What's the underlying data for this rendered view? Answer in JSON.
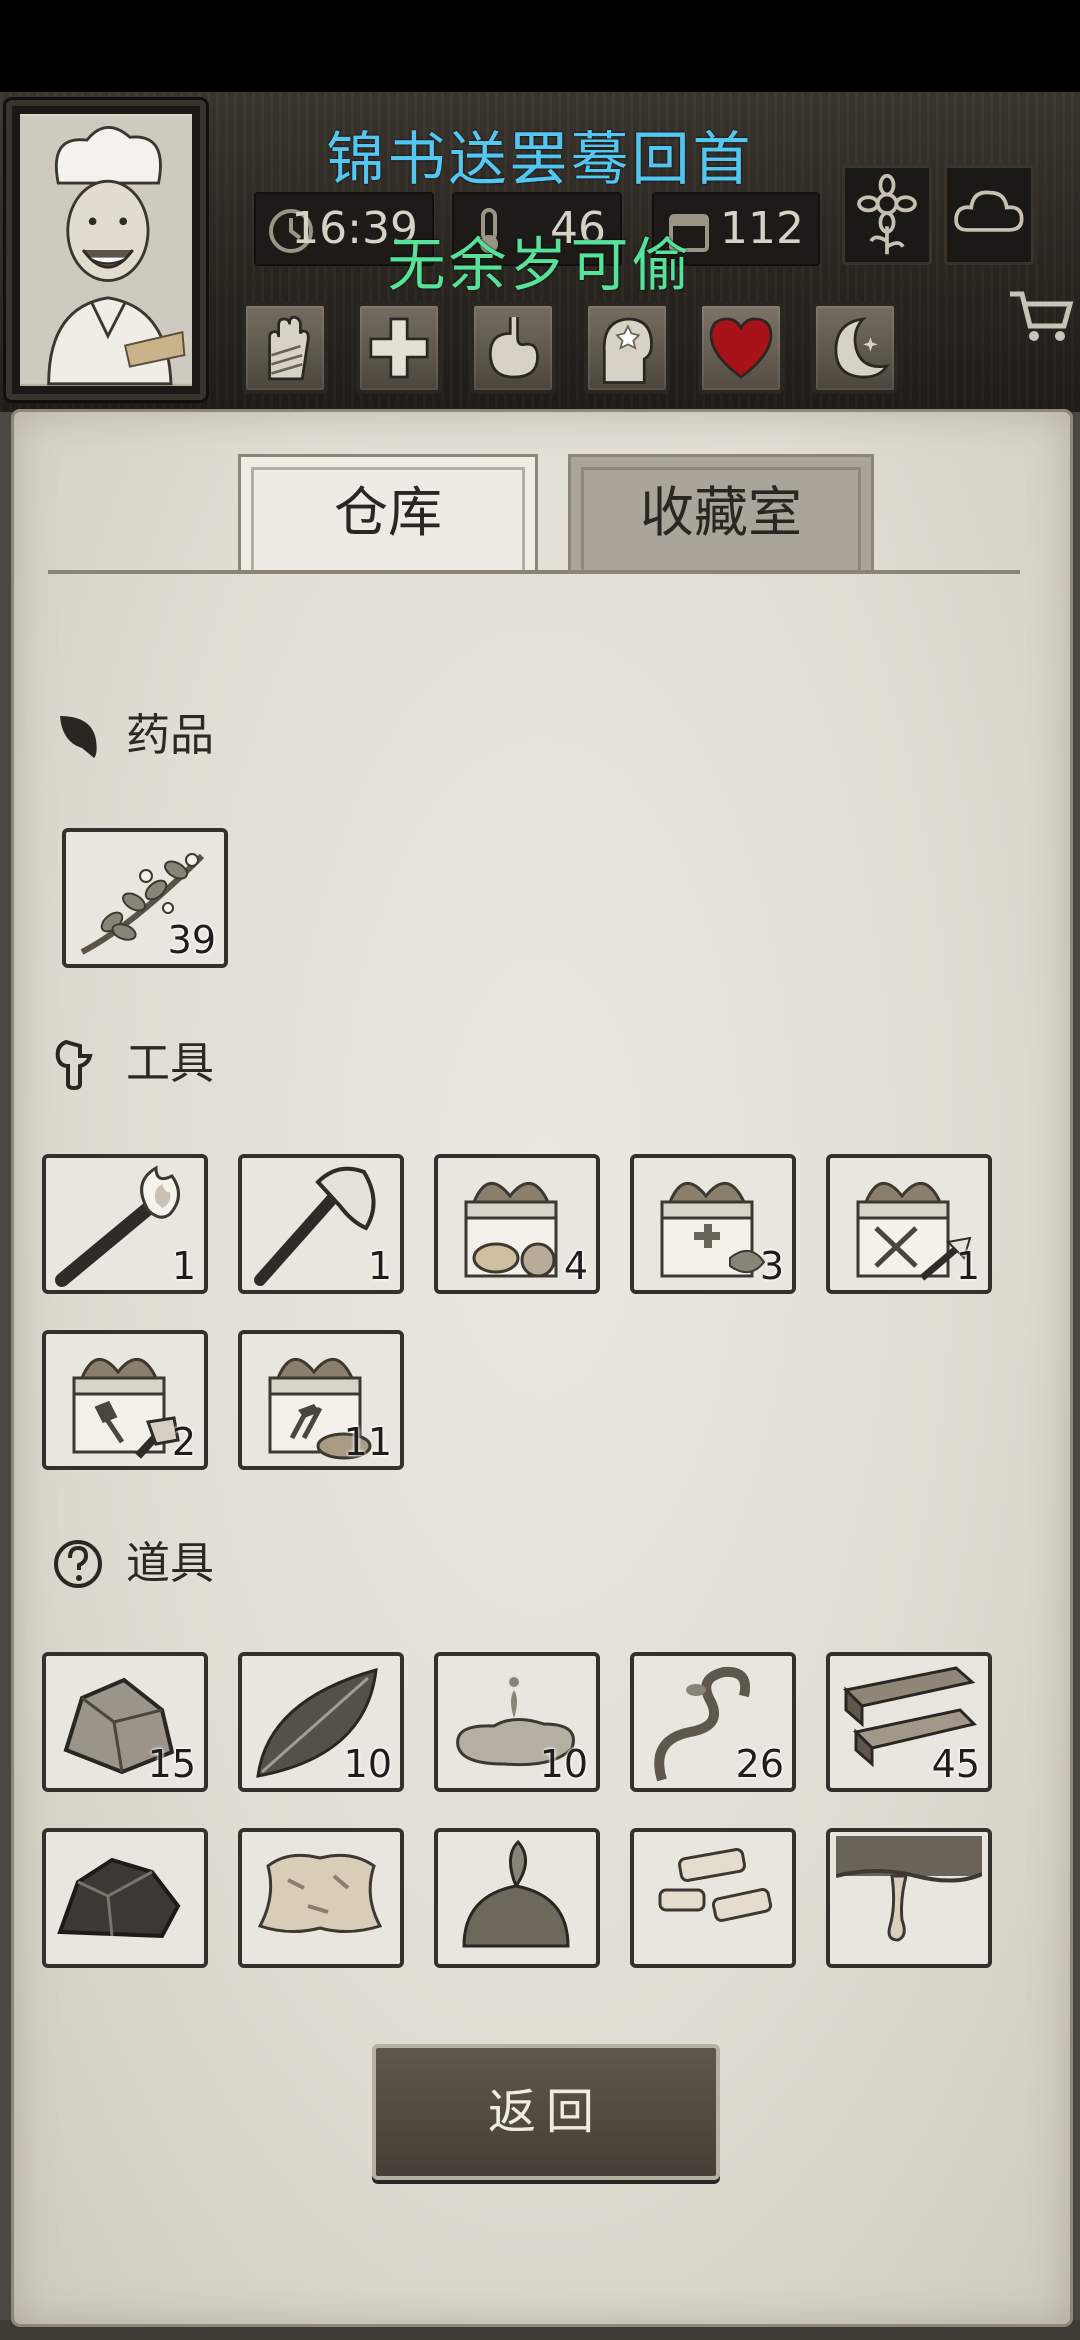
{
  "overlay": {
    "line1": "锦书送罢蓦回首",
    "line2": "无余岁可偷"
  },
  "header": {
    "time": "16:39",
    "temperature": "46",
    "days": "112",
    "weather_icons": [
      "flower-icon",
      "cloud-icon"
    ],
    "status_icons": [
      "bandaged-hand-icon",
      "health-cross-icon",
      "stomach-icon",
      "head-mood-icon",
      "heart-icon",
      "moon-sleep-icon"
    ],
    "accent_colors": {
      "line1": "#53c7f2",
      "line2": "#57e29c",
      "heart": "#a8131a"
    }
  },
  "tabs": [
    {
      "label": "仓库",
      "active": true
    },
    {
      "label": "收藏室",
      "active": false
    }
  ],
  "sections": {
    "medicine": {
      "title": "药品",
      "items": [
        {
          "icon": "herb-branch-icon",
          "count": "39"
        }
      ]
    },
    "tools": {
      "title": "工具",
      "items": [
        {
          "icon": "torch-icon",
          "count": "1"
        },
        {
          "icon": "axe-icon",
          "count": "1"
        },
        {
          "icon": "food-gift-box-icon",
          "count": "4"
        },
        {
          "icon": "medical-gift-box-icon",
          "count": "3"
        },
        {
          "icon": "weapon-gift-box-icon",
          "count": "1"
        },
        {
          "icon": "tool-gift-box-icon",
          "count": "2"
        },
        {
          "icon": "hammer-gift-box-icon",
          "count": "11"
        }
      ]
    },
    "props": {
      "title": "道具",
      "items": [
        {
          "icon": "stone-icon",
          "count": "15"
        },
        {
          "icon": "leaf-icon",
          "count": "10"
        },
        {
          "icon": "water-puddle-icon",
          "count": "10"
        },
        {
          "icon": "vine-icon",
          "count": "26"
        },
        {
          "icon": "wood-planks-icon",
          "count": "45"
        },
        {
          "icon": "coal-ore-icon",
          "count": ""
        },
        {
          "icon": "animal-hide-icon",
          "count": ""
        },
        {
          "icon": "herb-leaves-icon",
          "count": ""
        },
        {
          "icon": "bone-pieces-icon",
          "count": ""
        },
        {
          "icon": "resin-branch-icon",
          "count": ""
        }
      ]
    }
  },
  "back_button": {
    "label": "返回"
  }
}
